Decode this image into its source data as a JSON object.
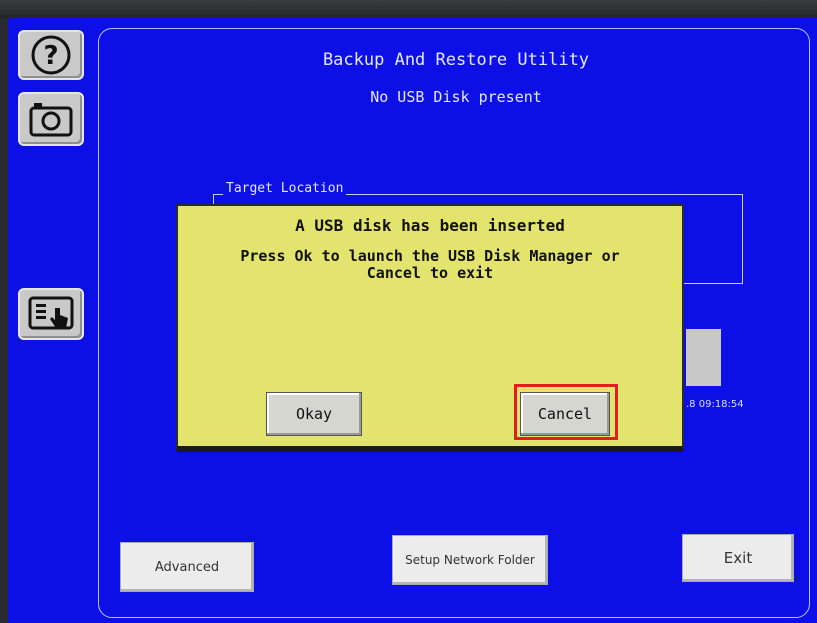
{
  "header": {
    "title": "Backup And Restore Utility",
    "status": "No USB Disk present"
  },
  "target_location": {
    "label": "Target Location"
  },
  "background": {
    "timestamp_partial": ".8 09:18:54"
  },
  "dialog": {
    "title": "A USB disk has been inserted",
    "message_line1": "Press Ok to launch the USB Disk Manager or",
    "message_line2": "Cancel to exit",
    "okay_label": "Okay",
    "cancel_label": "Cancel"
  },
  "footer": {
    "advanced_label": "Advanced",
    "network_label": "Setup Network Folder",
    "exit_label": "Exit"
  },
  "sidebar": {
    "icons": [
      "help-icon",
      "camera-icon",
      "touch-panel-icon"
    ]
  },
  "colors": {
    "screen_bg": "#0d10e6",
    "dialog_bg": "#e3e46d",
    "highlight": "#e02020"
  }
}
